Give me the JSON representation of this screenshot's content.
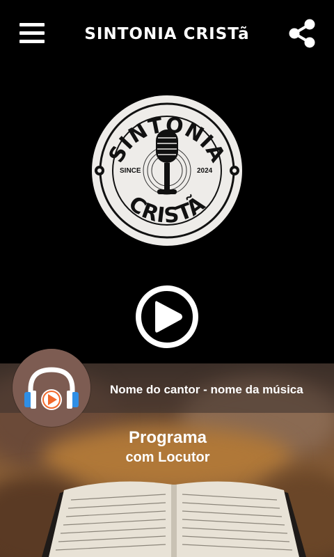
{
  "header": {
    "title": "SINTONIA CRISTã",
    "menu_icon": "hamburger-menu-icon",
    "share_icon": "share-icon"
  },
  "logo": {
    "top_text": "SINTONIA",
    "bottom_text": "CRISTÃ",
    "left_text": "SINCE",
    "right_text": "2024",
    "icon": "microphone-icon"
  },
  "player": {
    "play_icon": "play-icon",
    "track": "Nome do cantor - nome da música",
    "album_icon": "headphones-play-icon"
  },
  "program": {
    "title": "Programa",
    "host": "com Locutor"
  },
  "colors": {
    "background": "#000000",
    "text": "#ffffff",
    "logo_bg": "#eeece9",
    "album_bg": "#7d5c52",
    "headphone_blue": "#2f8fe6",
    "play_orange": "#f26a2c"
  }
}
